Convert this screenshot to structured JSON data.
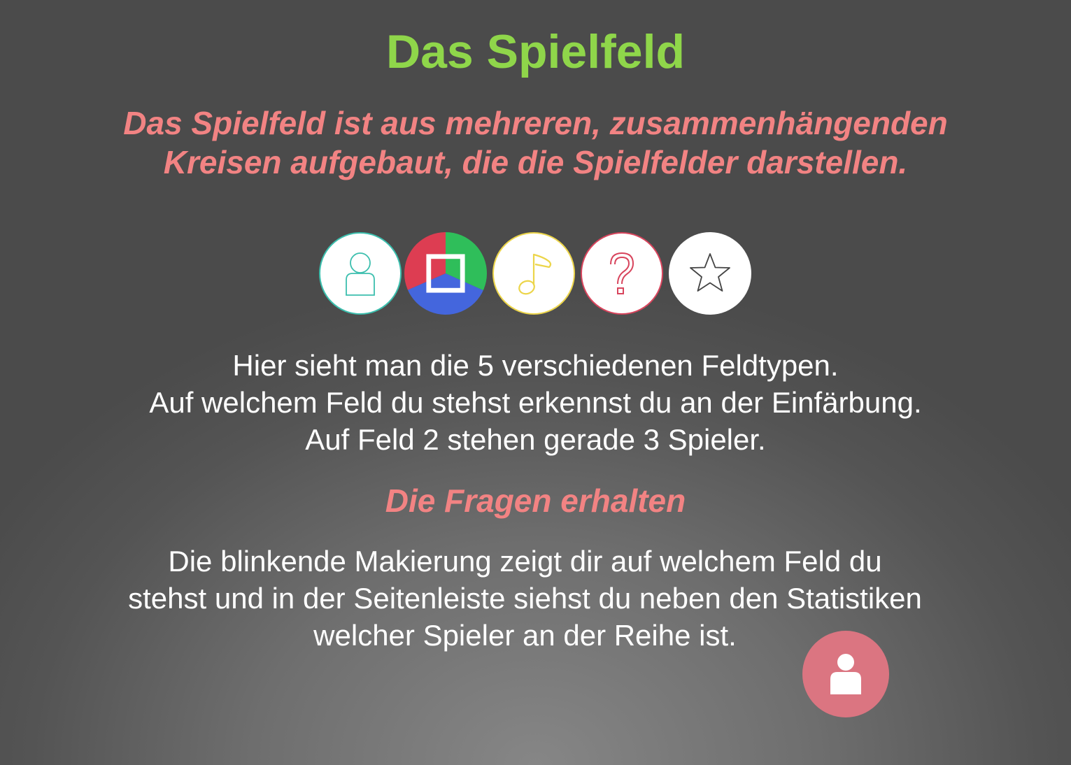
{
  "title": "Das Spielfeld",
  "subtitle": {
    "line1": "Das Spielfeld ist aus mehreren, zusammenhängenden",
    "line2": "Kreisen aufgebaut, die die Spielfelder darstellen."
  },
  "field_types": [
    {
      "icon": "person-icon",
      "color": "#3cbfae"
    },
    {
      "icon": "square-icon",
      "colors": [
        "#2fbe5a",
        "#4466dd",
        "#dd3d52"
      ]
    },
    {
      "icon": "music-note-icon",
      "color": "#ecd54a"
    },
    {
      "icon": "question-mark-icon",
      "color": "#d8455d"
    },
    {
      "icon": "star-icon",
      "color": "#444444"
    }
  ],
  "description": {
    "line1": "Hier sieht man die 5 verschiedenen Feldtypen.",
    "line2": "Auf welchem Feld du stehst erkennst du an der Einfärbung.",
    "line3": "Auf Feld 2 stehen gerade 3 Spieler."
  },
  "section_heading": "Die Fragen erhalten",
  "section_text": {
    "line1": "Die blinkende Makierung zeigt dir auf welchem Feld du",
    "line2": "stehst und in der Seitenleiste siehst du neben den Statistiken",
    "line3": "welcher Spieler an der Reihe ist."
  },
  "player_marker": {
    "icon": "person-icon",
    "color": "#db7581"
  },
  "colors": {
    "title": "#8fd64a",
    "accent": "#f28383",
    "text": "#ffffff"
  }
}
